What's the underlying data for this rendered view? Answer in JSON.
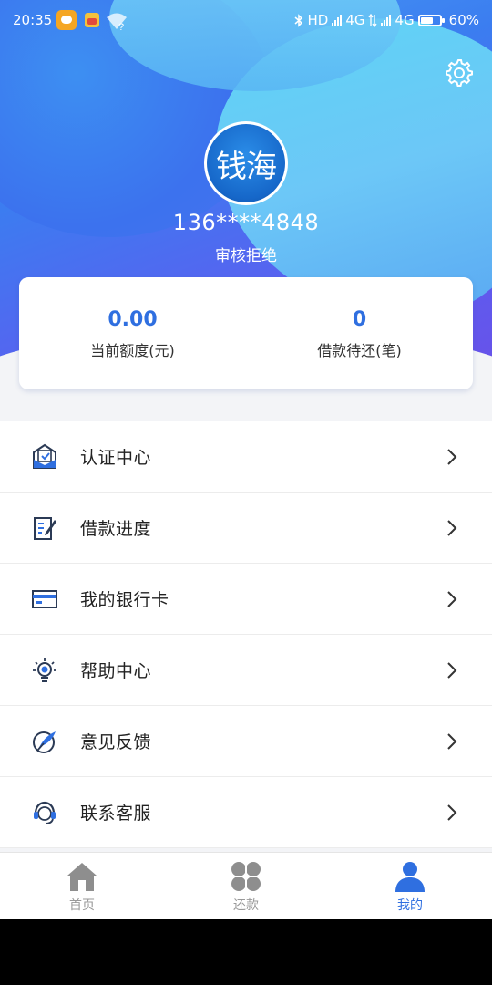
{
  "status_bar": {
    "time": "20:35",
    "hd": "HD",
    "net1": "4G",
    "net2": "4G",
    "battery": "60%"
  },
  "profile": {
    "avatar_text": "钱海",
    "phone": "136****4848",
    "status": "审核拒绝"
  },
  "stats": {
    "credit_value": "0.00",
    "credit_label": "当前额度(元)",
    "pending_value": "0",
    "pending_label": "借款待还(笔)"
  },
  "menu": [
    {
      "label": "认证中心",
      "icon": "id-card-icon"
    },
    {
      "label": "借款进度",
      "icon": "progress-doc-icon"
    },
    {
      "label": "我的银行卡",
      "icon": "bank-card-icon"
    },
    {
      "label": "帮助中心",
      "icon": "lightbulb-icon"
    },
    {
      "label": "意见反馈",
      "icon": "feather-icon"
    },
    {
      "label": "联系客服",
      "icon": "headset-icon"
    }
  ],
  "nav": [
    {
      "label": "首页",
      "icon": "home-icon"
    },
    {
      "label": "还款",
      "icon": "grid-icon"
    },
    {
      "label": "我的",
      "icon": "user-icon",
      "active": true
    }
  ],
  "colors": {
    "accent": "#2f6fe0",
    "inactive": "#999999"
  }
}
